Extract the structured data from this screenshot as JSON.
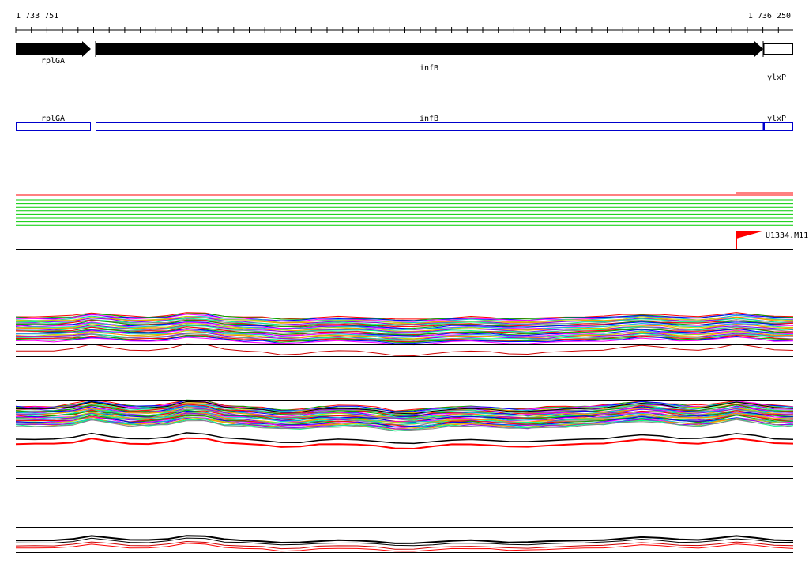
{
  "ruler": {
    "start_label": "1 733 751",
    "end_label": "1 736 250"
  },
  "genes": [
    {
      "name": "rplGA",
      "strand": "+",
      "fill": "#000000"
    },
    {
      "name": "infB",
      "strand": "+",
      "fill": "#000000"
    },
    {
      "name": "ylxP",
      "strand": "+",
      "fill": "#ffffff"
    }
  ],
  "annotation_boxes": [
    {
      "name": "rplGA",
      "color": "#0000cc"
    },
    {
      "name": "infB",
      "color": "#0000cc"
    },
    {
      "name": "ylxP",
      "color": "#0000cc"
    }
  ],
  "feature_marker": {
    "label": "U1334.M11",
    "color": "#ff0000"
  },
  "colors": {
    "forward_reads": "#00cc00",
    "reverse_read": "#ff0000",
    "baseline": "#000000",
    "profile_palette": [
      "#ff0000",
      "#00aa00",
      "#0000ff",
      "#ff00ff",
      "#00cccc",
      "#cccc00",
      "#ff8800",
      "#8800ff",
      "#00ff88",
      "#888888"
    ]
  },
  "tracks": [
    {
      "id": "reads"
    },
    {
      "id": "profiles-1"
    },
    {
      "id": "profiles-2"
    },
    {
      "id": "profiles-3"
    }
  ]
}
